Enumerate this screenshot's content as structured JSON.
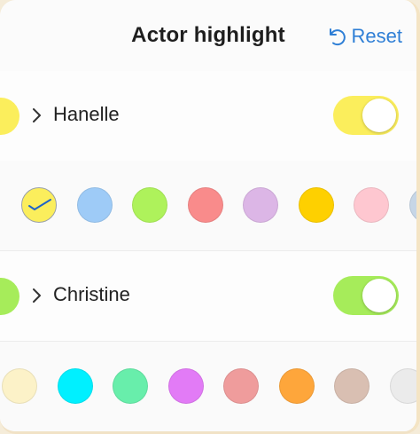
{
  "header": {
    "title": "Actor highlight",
    "reset_label": "Reset",
    "reset_icon": "undo-icon"
  },
  "actors": [
    {
      "name": "Hanelle",
      "color": "#fbee5c",
      "toggle_color": "#fbee5c",
      "enabled": true,
      "swatches": [
        "#fbee5c",
        "#9ecbf7",
        "#aef25b",
        "#f98b8b",
        "#dcb6e6",
        "#fed000",
        "#fec7d0",
        "#c6d6e6"
      ],
      "selected_index": 0
    },
    {
      "name": "Christine",
      "color": "#a6ec5a",
      "toggle_color": "#a6ec5a",
      "enabled": true,
      "swatches": [
        "#fcf2c8",
        "#00f0ff",
        "#68eeab",
        "#e27bf6",
        "#ef9c9c",
        "#fea63b",
        "#d9bfb2",
        "#ebebeb"
      ],
      "selected_index": -1
    }
  ],
  "colors": {
    "accent": "#2f7fd6",
    "check": "#1f64c8"
  }
}
